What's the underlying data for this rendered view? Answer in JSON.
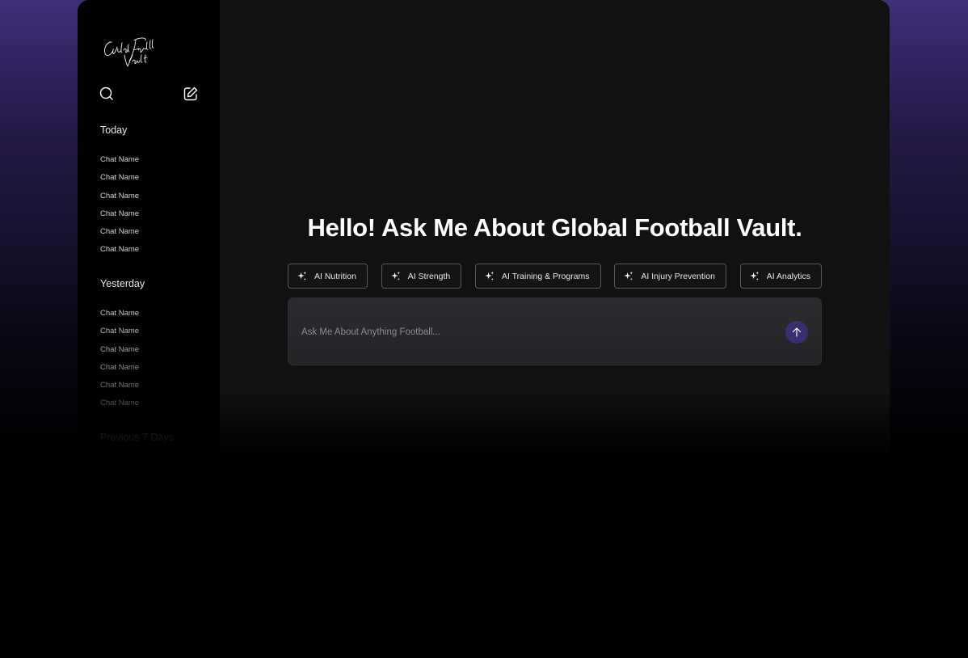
{
  "app": {
    "logo_text": "Global Football Vault",
    "accent_color": "#3a2f6e"
  },
  "sidebar": {
    "search_icon": "search-icon",
    "new_chat_icon": "edit-icon",
    "sections": [
      {
        "title": "Today",
        "items": [
          "Chat Name",
          "Chat Name",
          "Chat Name",
          "Chat Name",
          "Chat Name",
          "Chat Name"
        ]
      },
      {
        "title": "Yesterday",
        "items": [
          "Chat Name",
          "Chat Name",
          "Chat Name",
          "Chat Name",
          "Chat Name",
          "Chat Name"
        ]
      },
      {
        "title": "Previous 7 Days",
        "items": []
      }
    ]
  },
  "main": {
    "heading": "Hello! Ask Me About Global Football Vault.",
    "chips": [
      {
        "label": "AI Nutrition",
        "icon": "sparkle-icon"
      },
      {
        "label": "AI Strength",
        "icon": "sparkle-icon"
      },
      {
        "label": "AI Training & Programs",
        "icon": "sparkle-icon"
      },
      {
        "label": "AI Injury Prevention",
        "icon": "sparkle-icon"
      },
      {
        "label": "AI Analytics",
        "icon": "sparkle-icon"
      }
    ],
    "composer": {
      "placeholder": "Ask Me About Anything Football...",
      "value": "",
      "send_icon": "arrow-up-icon"
    }
  }
}
